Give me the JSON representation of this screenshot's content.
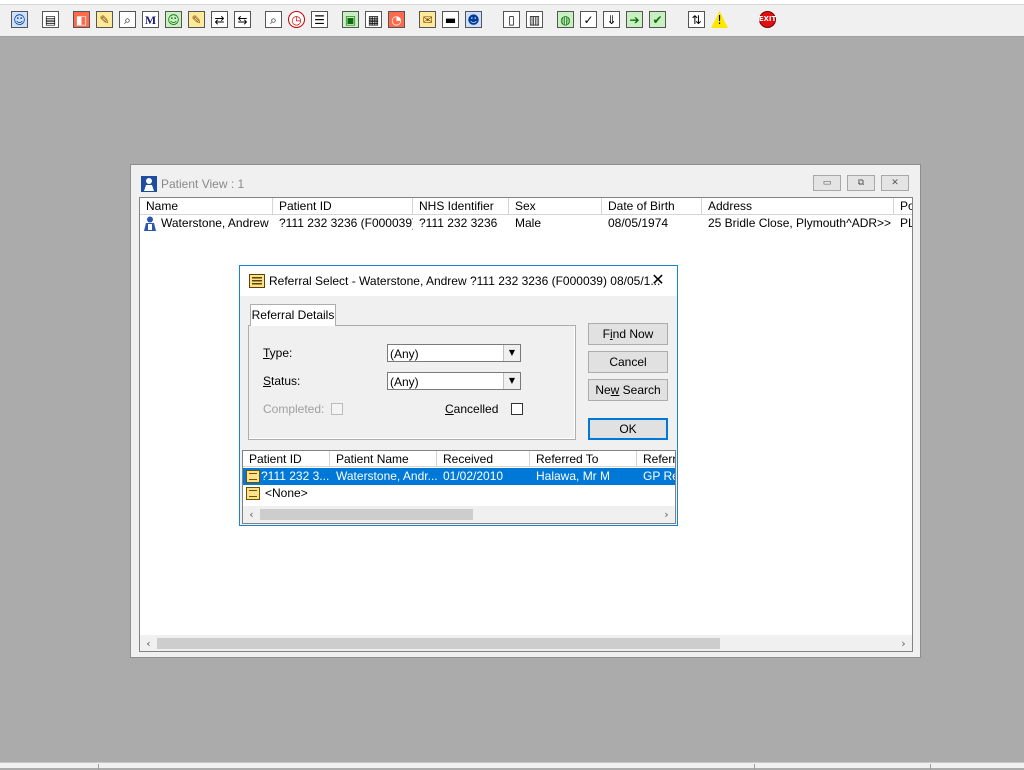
{
  "toolbar": {
    "buttons": [
      {
        "icon": "patient-icon",
        "glyph": "☺",
        "style": "person"
      },
      {
        "icon": "register-icon",
        "glyph": "▤",
        "style": ""
      },
      {
        "icon": "records-icon",
        "glyph": "◧",
        "style": "red"
      },
      {
        "icon": "edit-record-icon",
        "glyph": "✎",
        "style": "folder"
      },
      {
        "icon": "search-records-icon",
        "glyph": "⌕",
        "style": ""
      },
      {
        "icon": "m-icon",
        "glyph": "M",
        "style": "m"
      },
      {
        "icon": "clinician-icon",
        "glyph": "☺",
        "style": "green"
      },
      {
        "icon": "notes-icon",
        "glyph": "✎",
        "style": "folder"
      },
      {
        "icon": "transfer-icon",
        "glyph": "⇄",
        "style": ""
      },
      {
        "icon": "transfer-out-icon",
        "glyph": "⇆",
        "style": ""
      },
      {
        "icon": "find-icon",
        "glyph": "⌕",
        "style": ""
      },
      {
        "icon": "clock-icon",
        "glyph": "◷",
        "style": "clock"
      },
      {
        "icon": "list-icon",
        "glyph": "☰",
        "style": ""
      },
      {
        "icon": "picture-icon",
        "glyph": "▣",
        "style": "green"
      },
      {
        "icon": "report-icon",
        "glyph": "▦",
        "style": ""
      },
      {
        "icon": "chart-icon",
        "glyph": "◔",
        "style": "red"
      },
      {
        "icon": "letter-icon",
        "glyph": "✉",
        "style": "folder"
      },
      {
        "icon": "bed-icon",
        "glyph": "▬",
        "style": ""
      },
      {
        "icon": "people-icon",
        "glyph": "☻",
        "style": "person"
      },
      {
        "icon": "document-icon",
        "glyph": "▯",
        "style": ""
      },
      {
        "icon": "bar-chart-icon",
        "glyph": "▥",
        "style": ""
      },
      {
        "icon": "globe-icon",
        "glyph": "◍",
        "style": "green"
      },
      {
        "icon": "check-icon",
        "glyph": "✓",
        "style": ""
      },
      {
        "icon": "download-icon",
        "glyph": "⇓",
        "style": ""
      },
      {
        "icon": "green-arrow-icon",
        "glyph": "➔",
        "style": "green"
      },
      {
        "icon": "green-check-icon",
        "glyph": "✔",
        "style": "green"
      },
      {
        "icon": "swap-icon",
        "glyph": "⇅",
        "style": ""
      },
      {
        "icon": "warning-icon",
        "glyph": "!",
        "style": "warn"
      },
      {
        "icon": "exit-icon",
        "glyph": "EXIT",
        "style": "exit"
      }
    ]
  },
  "patient_view": {
    "title": "Patient View : 1",
    "columns": [
      "Name",
      "Patient ID",
      "NHS Identifier",
      "Sex",
      "Date of Birth",
      "Address",
      "Po"
    ],
    "rows": [
      {
        "name": "Waterstone, Andrew",
        "patient_id": "?111 232 3236 (F000039)",
        "nhs_identifier": "?111 232 3236",
        "sex": "Male",
        "dob": "08/05/1974",
        "address": "25 Bridle Close, Plymouth^ADR>>",
        "po": "PL"
      }
    ]
  },
  "referral_dialog": {
    "title": "Referral Select - Waterstone, Andrew ?111 232 3236 (F000039) 08/05/1...",
    "tab": "Referral Details",
    "type_label_u": "T",
    "type_label_rest": "ype:",
    "type_value": "(Any)",
    "status_label_u": "S",
    "status_label_rest": "tatus:",
    "status_value": "(Any)",
    "completed_label": "Completed:",
    "cancelled_label_u": "C",
    "cancelled_label_rest": "ancelled",
    "buttons": {
      "find_now_pre": "F",
      "find_now_u": "i",
      "find_now_post": "nd Now",
      "cancel": "Cancel",
      "new_search_pre": "Ne",
      "new_search_u": "w",
      "new_search_post": " Search",
      "ok": "OK"
    },
    "columns": [
      "Patient ID",
      "Patient Name",
      "Received",
      "Referred To",
      "Referra"
    ],
    "rows": [
      {
        "patient_id": "?111 232 3...",
        "patient_name": "Waterstone, Andr...",
        "received": "01/02/2010",
        "referred_to": "Halawa, Mr M",
        "referral": "GP Re"
      }
    ],
    "none_item": "<None>"
  },
  "colors": {
    "selection": "#0078d7",
    "desktop": "#ababab"
  }
}
